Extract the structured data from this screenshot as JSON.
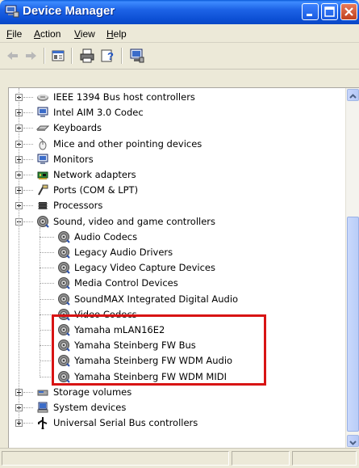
{
  "window": {
    "title": "Device Manager"
  },
  "menu": [
    {
      "label": "File",
      "u": "F",
      "rest": "ile"
    },
    {
      "label": "Action",
      "u": "A",
      "rest": "ction"
    },
    {
      "label": "View",
      "u": "V",
      "rest": "iew"
    },
    {
      "label": "Help",
      "u": "H",
      "rest": "elp"
    }
  ],
  "toolbar": [
    {
      "name": "back-icon"
    },
    {
      "name": "forward-icon"
    },
    {
      "name": "properties-icon"
    },
    {
      "name": "print-icon"
    },
    {
      "name": "help-icon"
    },
    {
      "name": "update-driver-icon"
    }
  ],
  "tree": [
    {
      "label": "IEEE 1394 Bus host controllers",
      "icon": "firewire-icon",
      "expander": "plus"
    },
    {
      "label": "Intel AIM 3.0 Codec",
      "icon": "monitor-icon",
      "expander": "plus"
    },
    {
      "label": "Keyboards",
      "icon": "keyboard-icon",
      "expander": "plus"
    },
    {
      "label": "Mice and other pointing devices",
      "icon": "mouse-icon",
      "expander": "plus"
    },
    {
      "label": "Monitors",
      "icon": "monitor-icon",
      "expander": "plus"
    },
    {
      "label": "Network adapters",
      "icon": "network-adapter-icon",
      "expander": "plus"
    },
    {
      "label": "Ports (COM & LPT)",
      "icon": "port-icon",
      "expander": "plus"
    },
    {
      "label": "Processors",
      "icon": "processor-icon",
      "expander": "plus"
    },
    {
      "label": "Sound, video and game controllers",
      "icon": "speaker-icon",
      "expander": "minus"
    },
    {
      "label": "Audio Codecs",
      "icon": "speaker-icon",
      "child": true
    },
    {
      "label": "Legacy Audio Drivers",
      "icon": "speaker-icon",
      "child": true
    },
    {
      "label": "Legacy Video Capture Devices",
      "icon": "speaker-icon",
      "child": true
    },
    {
      "label": "Media Control Devices",
      "icon": "speaker-icon",
      "child": true
    },
    {
      "label": "SoundMAX Integrated Digital Audio",
      "icon": "speaker-icon",
      "child": true
    },
    {
      "label": "Video Codecs",
      "icon": "speaker-icon",
      "child": true
    },
    {
      "label": "Yamaha mLAN16E2",
      "icon": "speaker-icon",
      "child": true
    },
    {
      "label": "Yamaha Steinberg FW Bus",
      "icon": "speaker-icon",
      "child": true
    },
    {
      "label": "Yamaha Steinberg FW WDM Audio",
      "icon": "speaker-icon",
      "child": true
    },
    {
      "label": "Yamaha Steinberg FW WDM MIDI",
      "icon": "speaker-icon",
      "child": true
    },
    {
      "label": "Storage volumes",
      "icon": "storage-icon",
      "expander": "plus"
    },
    {
      "label": "System devices",
      "icon": "computer-icon",
      "expander": "plus"
    },
    {
      "label": "Universal Serial Bus controllers",
      "icon": "usb-icon",
      "expander": "plus"
    }
  ],
  "colors": {
    "highlight": "#d81414",
    "titlebar": "#0c4fd4"
  }
}
